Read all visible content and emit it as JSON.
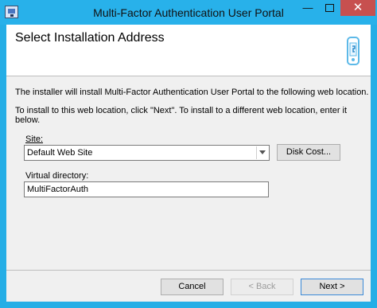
{
  "window": {
    "title": "Multi-Factor Authentication User Portal",
    "minimize_glyph": "—",
    "close_glyph": "✕"
  },
  "header": {
    "title": "Select Installation Address",
    "icon": "phone-icon"
  },
  "body": {
    "line1": "The installer will install Multi-Factor Authentication User Portal to the following web location.",
    "line2": "To install to this web location, click \"Next\". To install to a different web location, enter it below."
  },
  "site": {
    "label": "Site:",
    "value": "Default Web Site"
  },
  "disk_cost_label": "Disk Cost...",
  "virtual_directory": {
    "label": "Virtual directory:",
    "value": "MultiFactorAuth"
  },
  "buttons": {
    "cancel": "Cancel",
    "back": "< Back",
    "next": "Next >"
  }
}
